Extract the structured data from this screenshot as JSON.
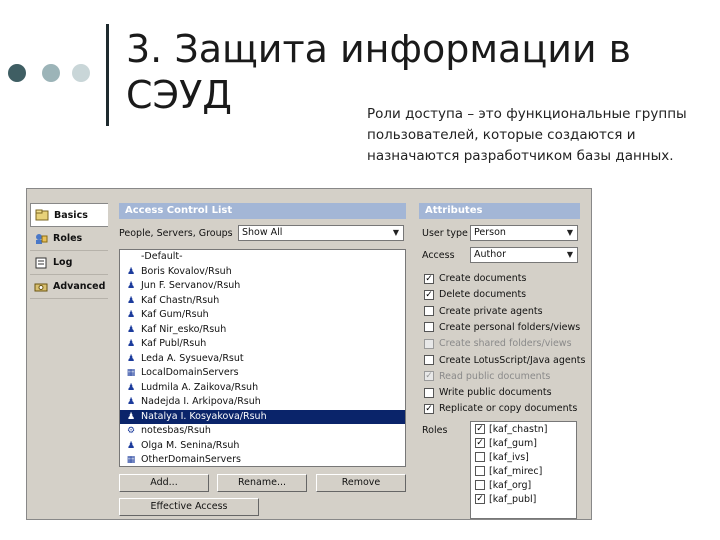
{
  "slide": {
    "title_line1": "3. Защита информации в",
    "title_line2": "СЭУД",
    "subtitle": "Роли доступа – это функциональные группы пользователей, которые создаются и назначаются разработчиком базы данных."
  },
  "nav": {
    "items": [
      {
        "label": "Basics",
        "icon": "basics-icon",
        "active": true
      },
      {
        "label": "Roles",
        "icon": "roles-icon",
        "active": false
      },
      {
        "label": "Log",
        "icon": "log-icon",
        "active": false
      },
      {
        "label": "Advanced",
        "icon": "advanced-icon",
        "active": false
      }
    ]
  },
  "acl": {
    "header": "Access Control List",
    "filter_label": "People, Servers, Groups",
    "filter_value": "Show All",
    "entries": [
      {
        "name": "-Default-",
        "icon": "none",
        "selected": false
      },
      {
        "name": "Boris Kovalov/Rsuh",
        "icon": "person-icon",
        "selected": false
      },
      {
        "name": "Jun F. Servanov/Rsuh",
        "icon": "person-icon",
        "selected": false
      },
      {
        "name": "Kaf Chastn/Rsuh",
        "icon": "person-icon",
        "selected": false
      },
      {
        "name": "Kaf Gum/Rsuh",
        "icon": "person-icon",
        "selected": false
      },
      {
        "name": "Kaf Nir_esko/Rsuh",
        "icon": "person-icon",
        "selected": false
      },
      {
        "name": "Kaf Publ/Rsuh",
        "icon": "person-icon",
        "selected": false
      },
      {
        "name": "Leda A. Sysueva/Rsut",
        "icon": "person-icon",
        "selected": false
      },
      {
        "name": "LocalDomainServers",
        "icon": "server-group-icon",
        "selected": false
      },
      {
        "name": "Ludmila A. Zaikova/Rsuh",
        "icon": "person-icon",
        "selected": false
      },
      {
        "name": "Nadejda I. Arkipova/Rsuh",
        "icon": "person-icon",
        "selected": false
      },
      {
        "name": "Natalya I. Kosyakova/Rsuh",
        "icon": "person-icon",
        "selected": true
      },
      {
        "name": "notesbas/Rsuh",
        "icon": "server-icon",
        "selected": false
      },
      {
        "name": "Olga M. Senina/Rsuh",
        "icon": "person-icon",
        "selected": false
      },
      {
        "name": "OtherDomainServers",
        "icon": "server-group-icon",
        "selected": false
      }
    ],
    "buttons": {
      "add": "Add...",
      "rename": "Rename...",
      "remove": "Remove",
      "effective": "Effective Access"
    }
  },
  "attributes": {
    "header": "Attributes",
    "user_type_label": "User type",
    "user_type_value": "Person",
    "access_label": "Access",
    "access_value": "Author",
    "options": [
      {
        "label": "Create documents",
        "checked": true,
        "disabled": false
      },
      {
        "label": "Delete documents",
        "checked": true,
        "disabled": false
      },
      {
        "label": "Create private agents",
        "checked": false,
        "disabled": false
      },
      {
        "label": "Create personal folders/views",
        "checked": false,
        "disabled": false
      },
      {
        "label": "Create shared folders/views",
        "checked": false,
        "disabled": true
      },
      {
        "label": "Create LotusScript/Java agents",
        "checked": false,
        "disabled": false
      },
      {
        "label": "Read public documents",
        "checked": true,
        "disabled": true
      },
      {
        "label": "Write public documents",
        "checked": false,
        "disabled": false
      },
      {
        "label": "Replicate or copy documents",
        "checked": true,
        "disabled": false
      }
    ],
    "roles_label": "Roles",
    "roles": [
      {
        "name": "[kaf_chastn]",
        "checked": true
      },
      {
        "name": "[kaf_gum]",
        "checked": true
      },
      {
        "name": "[kaf_ivs]",
        "checked": false
      },
      {
        "name": "[kaf_mirec]",
        "checked": false
      },
      {
        "name": "[kaf_org]",
        "checked": false
      },
      {
        "name": "[kaf_publ]",
        "checked": true
      }
    ]
  }
}
